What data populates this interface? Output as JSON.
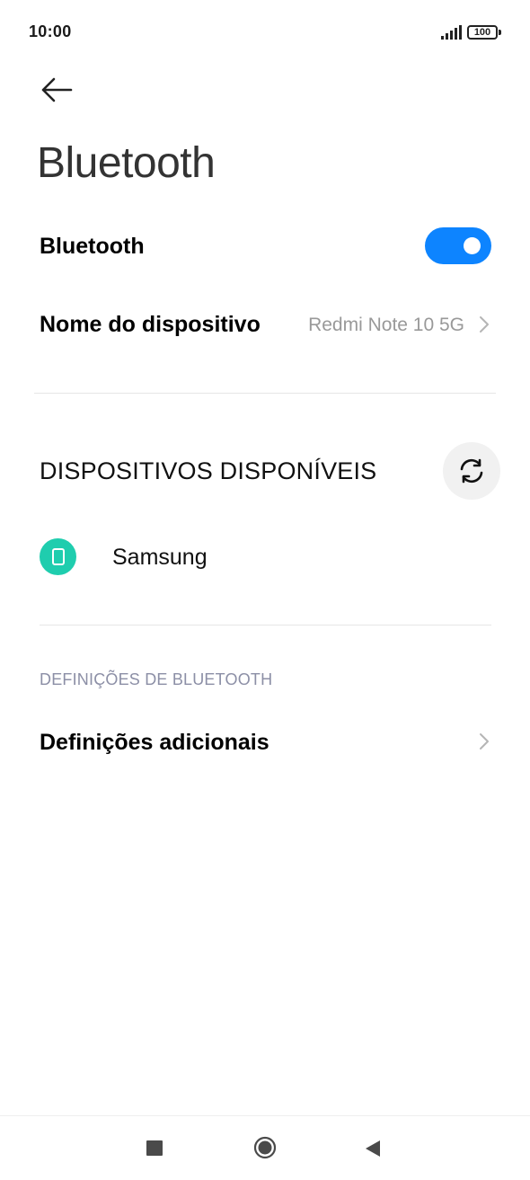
{
  "status_bar": {
    "time": "10:00",
    "battery": "100",
    "icons": [
      "signal-icon",
      "battery-icon"
    ]
  },
  "header": {
    "back_icon": "arrow-left-icon",
    "title": "Bluetooth"
  },
  "bluetooth_toggle": {
    "label": "Bluetooth",
    "enabled": true,
    "accent_color": "#0d84ff"
  },
  "device_name_row": {
    "label": "Nome do dispositivo",
    "value": "Redmi Note 10 5G",
    "icon": "chevron-right-icon"
  },
  "available_devices": {
    "heading": "DISPOSITIVOS DISPONÍVEIS",
    "refresh_icon": "refresh-icon",
    "devices": [
      {
        "name": "Samsung",
        "icon": "phone-icon",
        "icon_color": "#1fcdae"
      }
    ]
  },
  "bluetooth_settings": {
    "heading": "DEFINIÇÕES DE BLUETOOTH",
    "items": [
      {
        "label": "Definições adicionais",
        "icon": "chevron-right-icon"
      }
    ]
  },
  "nav_bar": {
    "icons": [
      "recent-apps-icon",
      "home-icon",
      "back-triangle-icon"
    ]
  }
}
